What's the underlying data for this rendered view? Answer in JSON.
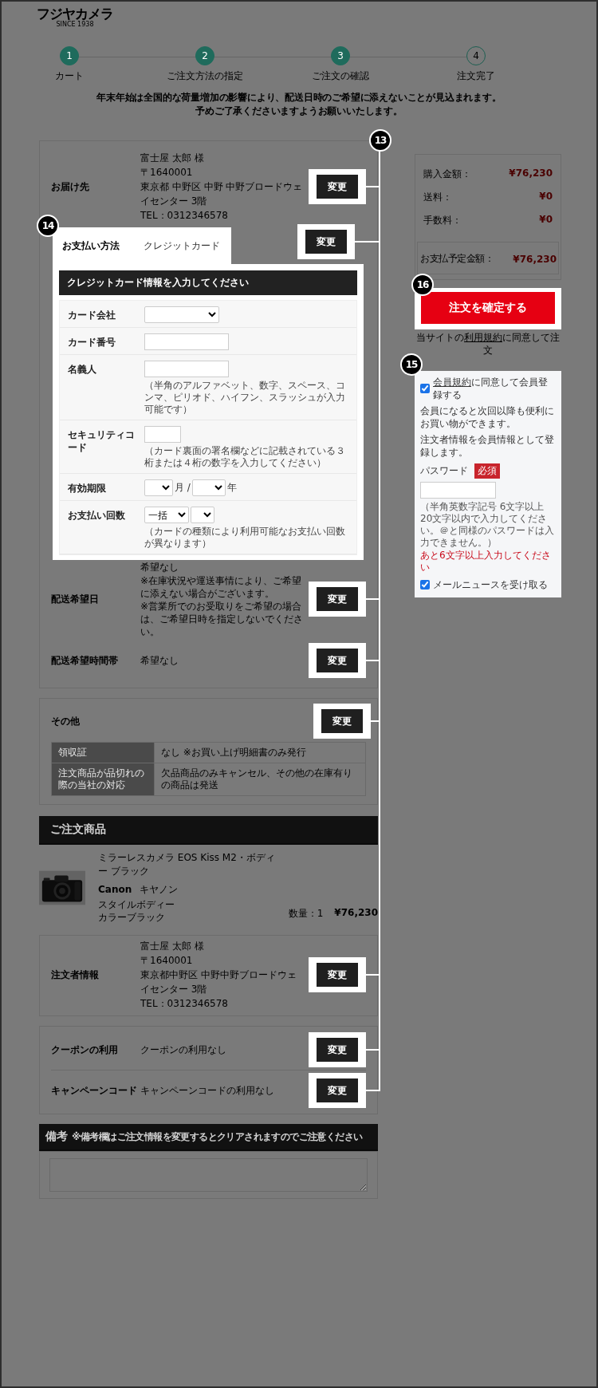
{
  "logo": {
    "name": "フジヤカメラ",
    "tagline": "SINCE 1938"
  },
  "steps": [
    {
      "number": "1",
      "label": "カート",
      "done": true
    },
    {
      "number": "2",
      "label": "ご注文方法の指定",
      "done": true
    },
    {
      "number": "3",
      "label": "ご注文の確認",
      "done": true
    },
    {
      "number": "4",
      "label": "注文完了",
      "done": false
    }
  ],
  "notice": [
    "年末年始は全国的な荷量増加の影響により、配送日時のご希望に添えないことが見込まれます。",
    "予めご了承くださいますようお願いいたします。"
  ],
  "callouts": {
    "change_buttons": "13",
    "payment": "14",
    "member": "15",
    "confirm": "16"
  },
  "delivery_panel": {
    "rows": [
      {
        "kind": "text",
        "label": "お届け先",
        "lines": [
          "富士屋 太郎 様",
          "〒1640001",
          "東京都 中野区 中野 中野ブロードウェイセンター 3階",
          "TEL：0312346578"
        ],
        "button": "変更"
      },
      {
        "kind": "payment",
        "label": "お支払い方法",
        "value": "クレジットカード",
        "button": "変更",
        "card_form": {
          "title": "クレジットカード情報を入力してください",
          "fields": [
            {
              "kind": "select",
              "label": "カード会社"
            },
            {
              "kind": "text",
              "label": "カード番号"
            },
            {
              "kind": "text",
              "label": "名義人",
              "note": "（半角のアルファベット、数字、スペース、コンマ、ピリオド、ハイフン、スラッシュが入力可能です）"
            },
            {
              "kind": "short",
              "label": "セキュリティコード",
              "note": "（カード裏面の署名欄などに記載されている３桁または４桁の数字を入力してください）"
            },
            {
              "kind": "expiry",
              "label": "有効期限",
              "month_unit": "月 /",
              "year_unit": "年"
            },
            {
              "kind": "installments",
              "label": "お支払い回数",
              "value": "一括",
              "note": "（カードの種類により利用可能なお支払い回数が異なります）"
            }
          ]
        }
      },
      {
        "kind": "text",
        "label": "配送希望日",
        "lines": [
          "希望なし"
        ],
        "notes": [
          "※在庫状況や運送事情により、ご希望に添えない場合がございます。",
          "※営業所でのお受取りをご希望の場合は、ご希望日時を指定しないでください。"
        ],
        "button": "変更"
      },
      {
        "kind": "text",
        "label": "配送希望時間帯",
        "lines": [
          "希望なし"
        ],
        "button": "変更"
      }
    ]
  },
  "other_panel": {
    "title": "その他",
    "button": "変更",
    "table": [
      [
        "領収証",
        "なし ※お買い上げ明細書のみ発行"
      ],
      [
        "注文商品が品切れの際の当社の対応",
        "欠品商品のみキャンセル、その他の在庫有りの商品は発送"
      ]
    ]
  },
  "products": {
    "title": "ご注文商品",
    "items": [
      {
        "name": "ミラーレスカメラ EOS Kiss M2・ボディー ブラック",
        "brand": "Canon",
        "brand_kana": "キヤノン",
        "options": [
          "スタイルボディー",
          "カラーブラック"
        ],
        "quantity": "数量：1",
        "price": "¥76,230"
      }
    ]
  },
  "orderer_panel": {
    "rows": [
      {
        "kind": "text",
        "label": "注文者情報",
        "lines": [
          "富士屋 太郎 様",
          "〒1640001",
          "東京都中野区 中野中野ブロードウェイセンター 3階",
          "TEL：0312346578"
        ],
        "button": "変更"
      }
    ]
  },
  "coupon_panel": {
    "rows": [
      {
        "kind": "text",
        "label": "クーポンの利用",
        "lines": [
          "クーポンの利用なし"
        ],
        "button": "変更"
      },
      {
        "kind": "text",
        "label": "キャンペーンコード",
        "lines": [
          "キャンペーンコードの利用なし"
        ],
        "button": "変更"
      }
    ]
  },
  "remarks": {
    "title": "備考",
    "note": "※備考欄はご注文情報を変更するとクリアされますのでご注意ください"
  },
  "summary": {
    "rows": [
      {
        "label": "購入金額：",
        "value": "¥76,230"
      },
      {
        "label": "送料：",
        "value": "¥0"
      },
      {
        "label": "手数料：",
        "value": "¥0"
      }
    ],
    "total": {
      "label": "お支払予定金額：",
      "value": "¥76,230"
    },
    "confirm_button": "注文を確定する",
    "terms": {
      "before": "当サイトの",
      "link": "利用規約",
      "after": "に同意して注文"
    }
  },
  "member": {
    "agree": {
      "checked": true,
      "link": "会員規約",
      "text": "に同意して会員登録する"
    },
    "description": [
      "会員になると次回以降も便利にお買い物ができます。",
      "注文者情報を会員情報として登録します。"
    ],
    "password": {
      "label": "パスワード",
      "badge": "必須",
      "hint": "（半角英数字記号 6文字以上20文字以内で入力してください。＠と同様のパスワードは入力できません。）",
      "error": "あと6文字以上入力してください"
    },
    "newsletter": {
      "checked": true,
      "label": "メールニュースを受け取る"
    }
  }
}
